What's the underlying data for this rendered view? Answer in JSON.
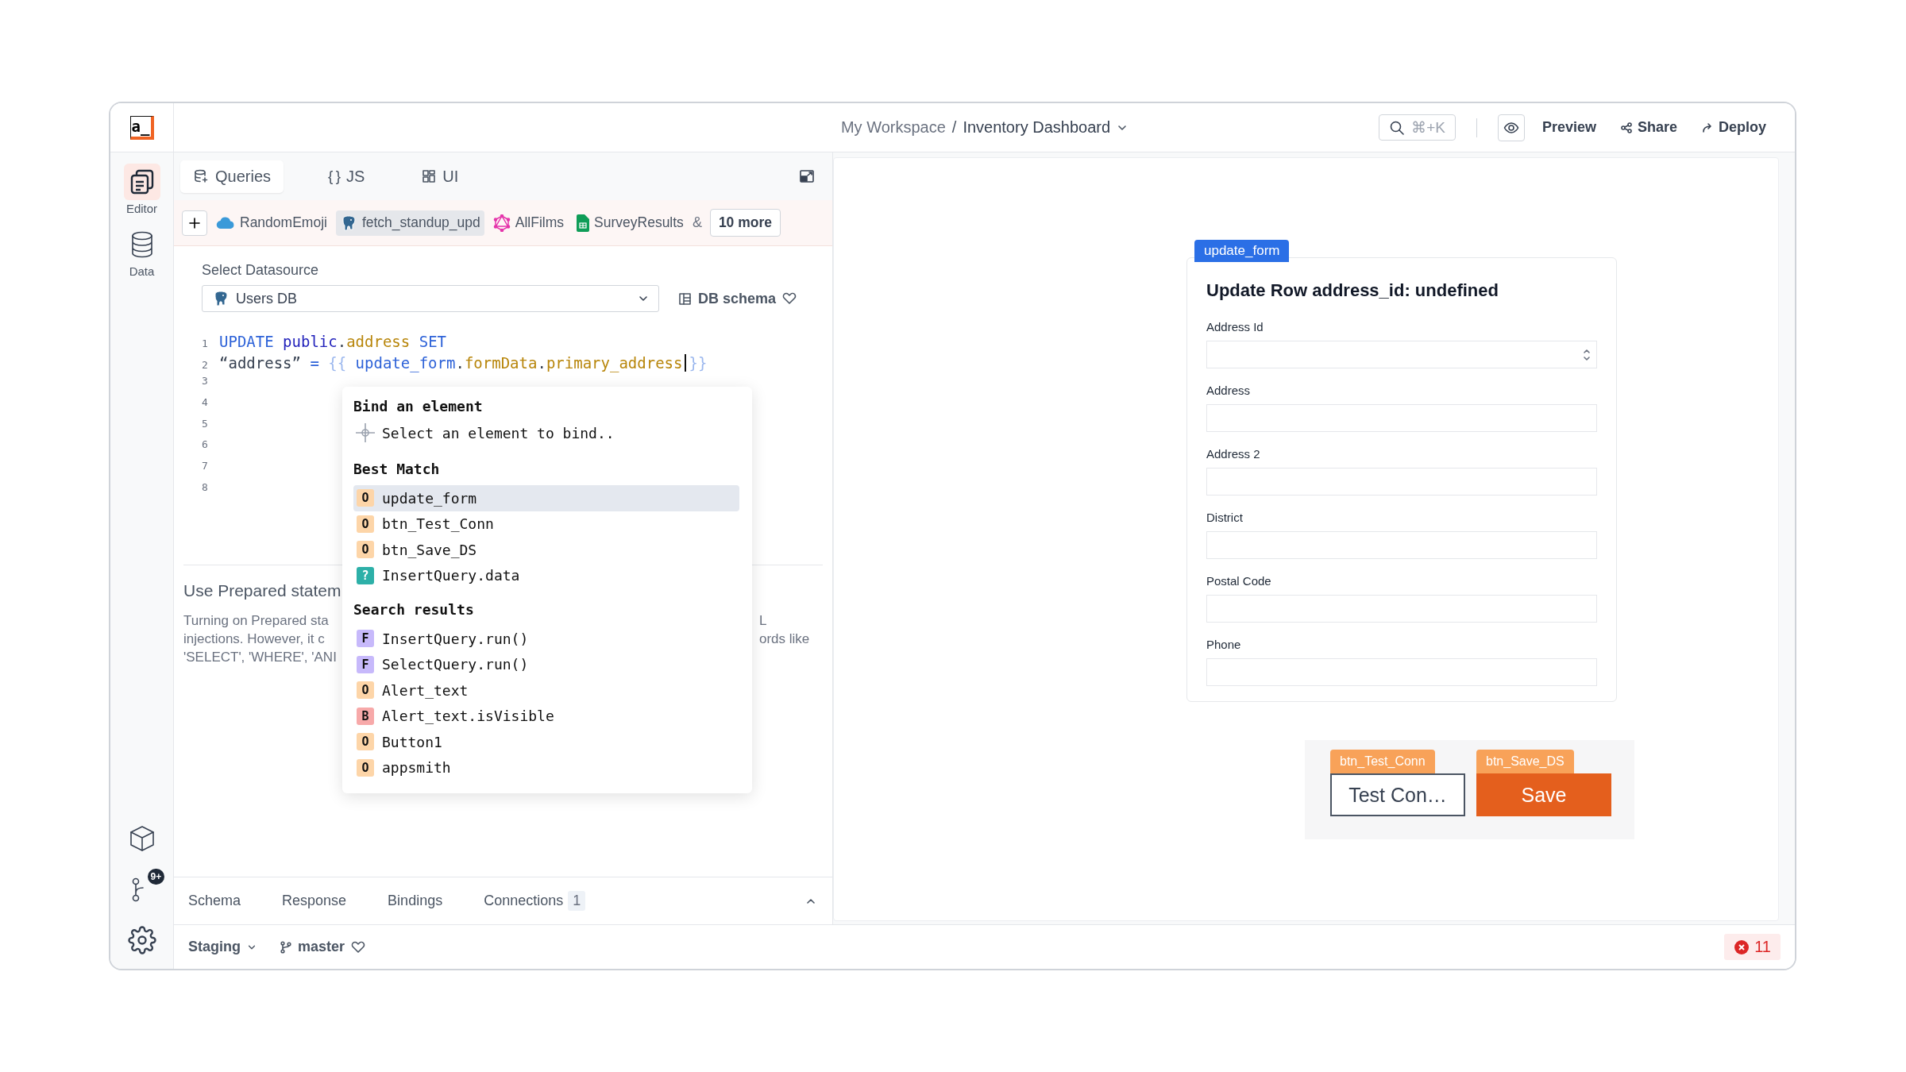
{
  "logo": {
    "text": "a_"
  },
  "top_bar": {
    "workspace": "My Workspace",
    "separator": "/",
    "app_name": "Inventory Dashboard",
    "search_shortcut": "⌘+K",
    "actions": [
      {
        "label": "Preview",
        "kind": "preview"
      },
      {
        "label": "Share",
        "kind": "share"
      },
      {
        "label": "Deploy",
        "kind": "deploy"
      }
    ]
  },
  "sidebar": {
    "items": [
      {
        "label": "Editor",
        "kind": "editor",
        "selected": true
      },
      {
        "label": "Data",
        "kind": "data",
        "selected": false
      }
    ],
    "git_badge": "9+"
  },
  "editor_tabs": [
    {
      "label": "Queries",
      "kind": "queries",
      "selected": true
    },
    {
      "label": "JS",
      "kind": "js",
      "glyph": "{ }",
      "selected": false
    },
    {
      "label": "UI",
      "kind": "ui",
      "selected": false
    }
  ],
  "query_tabs": {
    "items": [
      {
        "label": "RandomEmoji",
        "kind": "cloud",
        "selected": false
      },
      {
        "label": "fetch_standup_upd",
        "kind": "postgres",
        "selected": true
      },
      {
        "label": "AllFilms",
        "kind": "graphql",
        "selected": false
      },
      {
        "label": "SurveyResults",
        "kind": "sheets",
        "selected": false
      }
    ],
    "overflow_mark": "&",
    "more": "10 more"
  },
  "datasource": {
    "label": "Select Datasource",
    "value": "Users DB",
    "schema_link": "DB schema"
  },
  "code": {
    "lines": [
      {
        "number": "1",
        "tokens": [
          {
            "text": "UPDATE",
            "kind": "keyword"
          },
          {
            "text": " public",
            "kind": "schema"
          },
          {
            "text": ".",
            "kind": "punct"
          },
          {
            "text": "address",
            "kind": "column"
          },
          {
            "text": " SET",
            "kind": "keyword"
          }
        ]
      },
      {
        "number": "2",
        "tokens": [
          {
            "text": "“address”",
            "kind": "string"
          },
          {
            "text": " = ",
            "kind": "operator"
          },
          {
            "text": "{{",
            "kind": "brace"
          },
          {
            "text": " update_form",
            "kind": "widget"
          },
          {
            "text": ".",
            "kind": "punct"
          },
          {
            "text": "formData",
            "kind": "column"
          },
          {
            "text": ".",
            "kind": "punct"
          },
          {
            "text": "primary_address",
            "kind": "column"
          },
          {
            "kind": "cursor"
          },
          {
            "text": "}}",
            "kind": "brace"
          }
        ]
      },
      {
        "number": "3"
      },
      {
        "number": "4"
      },
      {
        "number": "5"
      },
      {
        "number": "6"
      },
      {
        "number": "7"
      },
      {
        "number": "8"
      }
    ]
  },
  "prepared": {
    "title": "Use Prepared statem",
    "text_left": [
      "Turning on Prepared sta",
      "injections. However, it c",
      "'SELECT', 'WHERE', 'ANI"
    ],
    "text_right": [
      "L",
      "ords like"
    ]
  },
  "autocomplete": {
    "bind_title": "Bind an element",
    "bind_hint": "Select an element to bind..",
    "sections": [
      {
        "title": "Best Match",
        "items": [
          {
            "badge": "O",
            "kind": "object",
            "label": "update_form",
            "selected": true
          },
          {
            "badge": "O",
            "kind": "object",
            "label": "btn_Test_Conn",
            "selected": false
          },
          {
            "badge": "O",
            "kind": "object",
            "label": "btn_Save_DS",
            "selected": false
          },
          {
            "badge": "?",
            "kind": "unknown",
            "label": "InsertQuery.data",
            "selected": false
          }
        ]
      },
      {
        "title": "Search results",
        "items": [
          {
            "badge": "F",
            "kind": "function",
            "label": "InsertQuery.run()",
            "selected": false
          },
          {
            "badge": "F",
            "kind": "function",
            "label": "SelectQuery.run()",
            "selected": false
          },
          {
            "badge": "O",
            "kind": "object",
            "label": "Alert_text",
            "selected": false
          },
          {
            "badge": "B",
            "kind": "boolean",
            "label": "Alert_text.isVisible",
            "selected": false
          },
          {
            "badge": "O",
            "kind": "object",
            "label": "Button1",
            "selected": false
          },
          {
            "badge": "O",
            "kind": "object",
            "label": "appsmith",
            "selected": false
          }
        ]
      }
    ]
  },
  "bottom_tabs": [
    {
      "label": "Schema"
    },
    {
      "label": "Response"
    },
    {
      "label": "Bindings"
    },
    {
      "label": "Connections",
      "count": "1"
    }
  ],
  "status_bar": {
    "environment": "Staging",
    "branch": "master",
    "error_count": "11"
  },
  "canvas": {
    "form": {
      "tag": "update_form",
      "title": "Update Row address_id: undefined",
      "fields": [
        {
          "label": "Address Id",
          "kind": "number"
        },
        {
          "label": "Address",
          "kind": "text"
        },
        {
          "label": "Address 2",
          "kind": "text"
        },
        {
          "label": "District",
          "kind": "text"
        },
        {
          "label": "Postal Code",
          "kind": "text"
        },
        {
          "label": "Phone",
          "kind": "text"
        }
      ]
    },
    "buttons": [
      {
        "tag": "btn_Test_Conn",
        "label": "Test Con…",
        "kind": "secondary"
      },
      {
        "tag": "btn_Save_DS",
        "label": "Save",
        "kind": "primary"
      }
    ]
  }
}
